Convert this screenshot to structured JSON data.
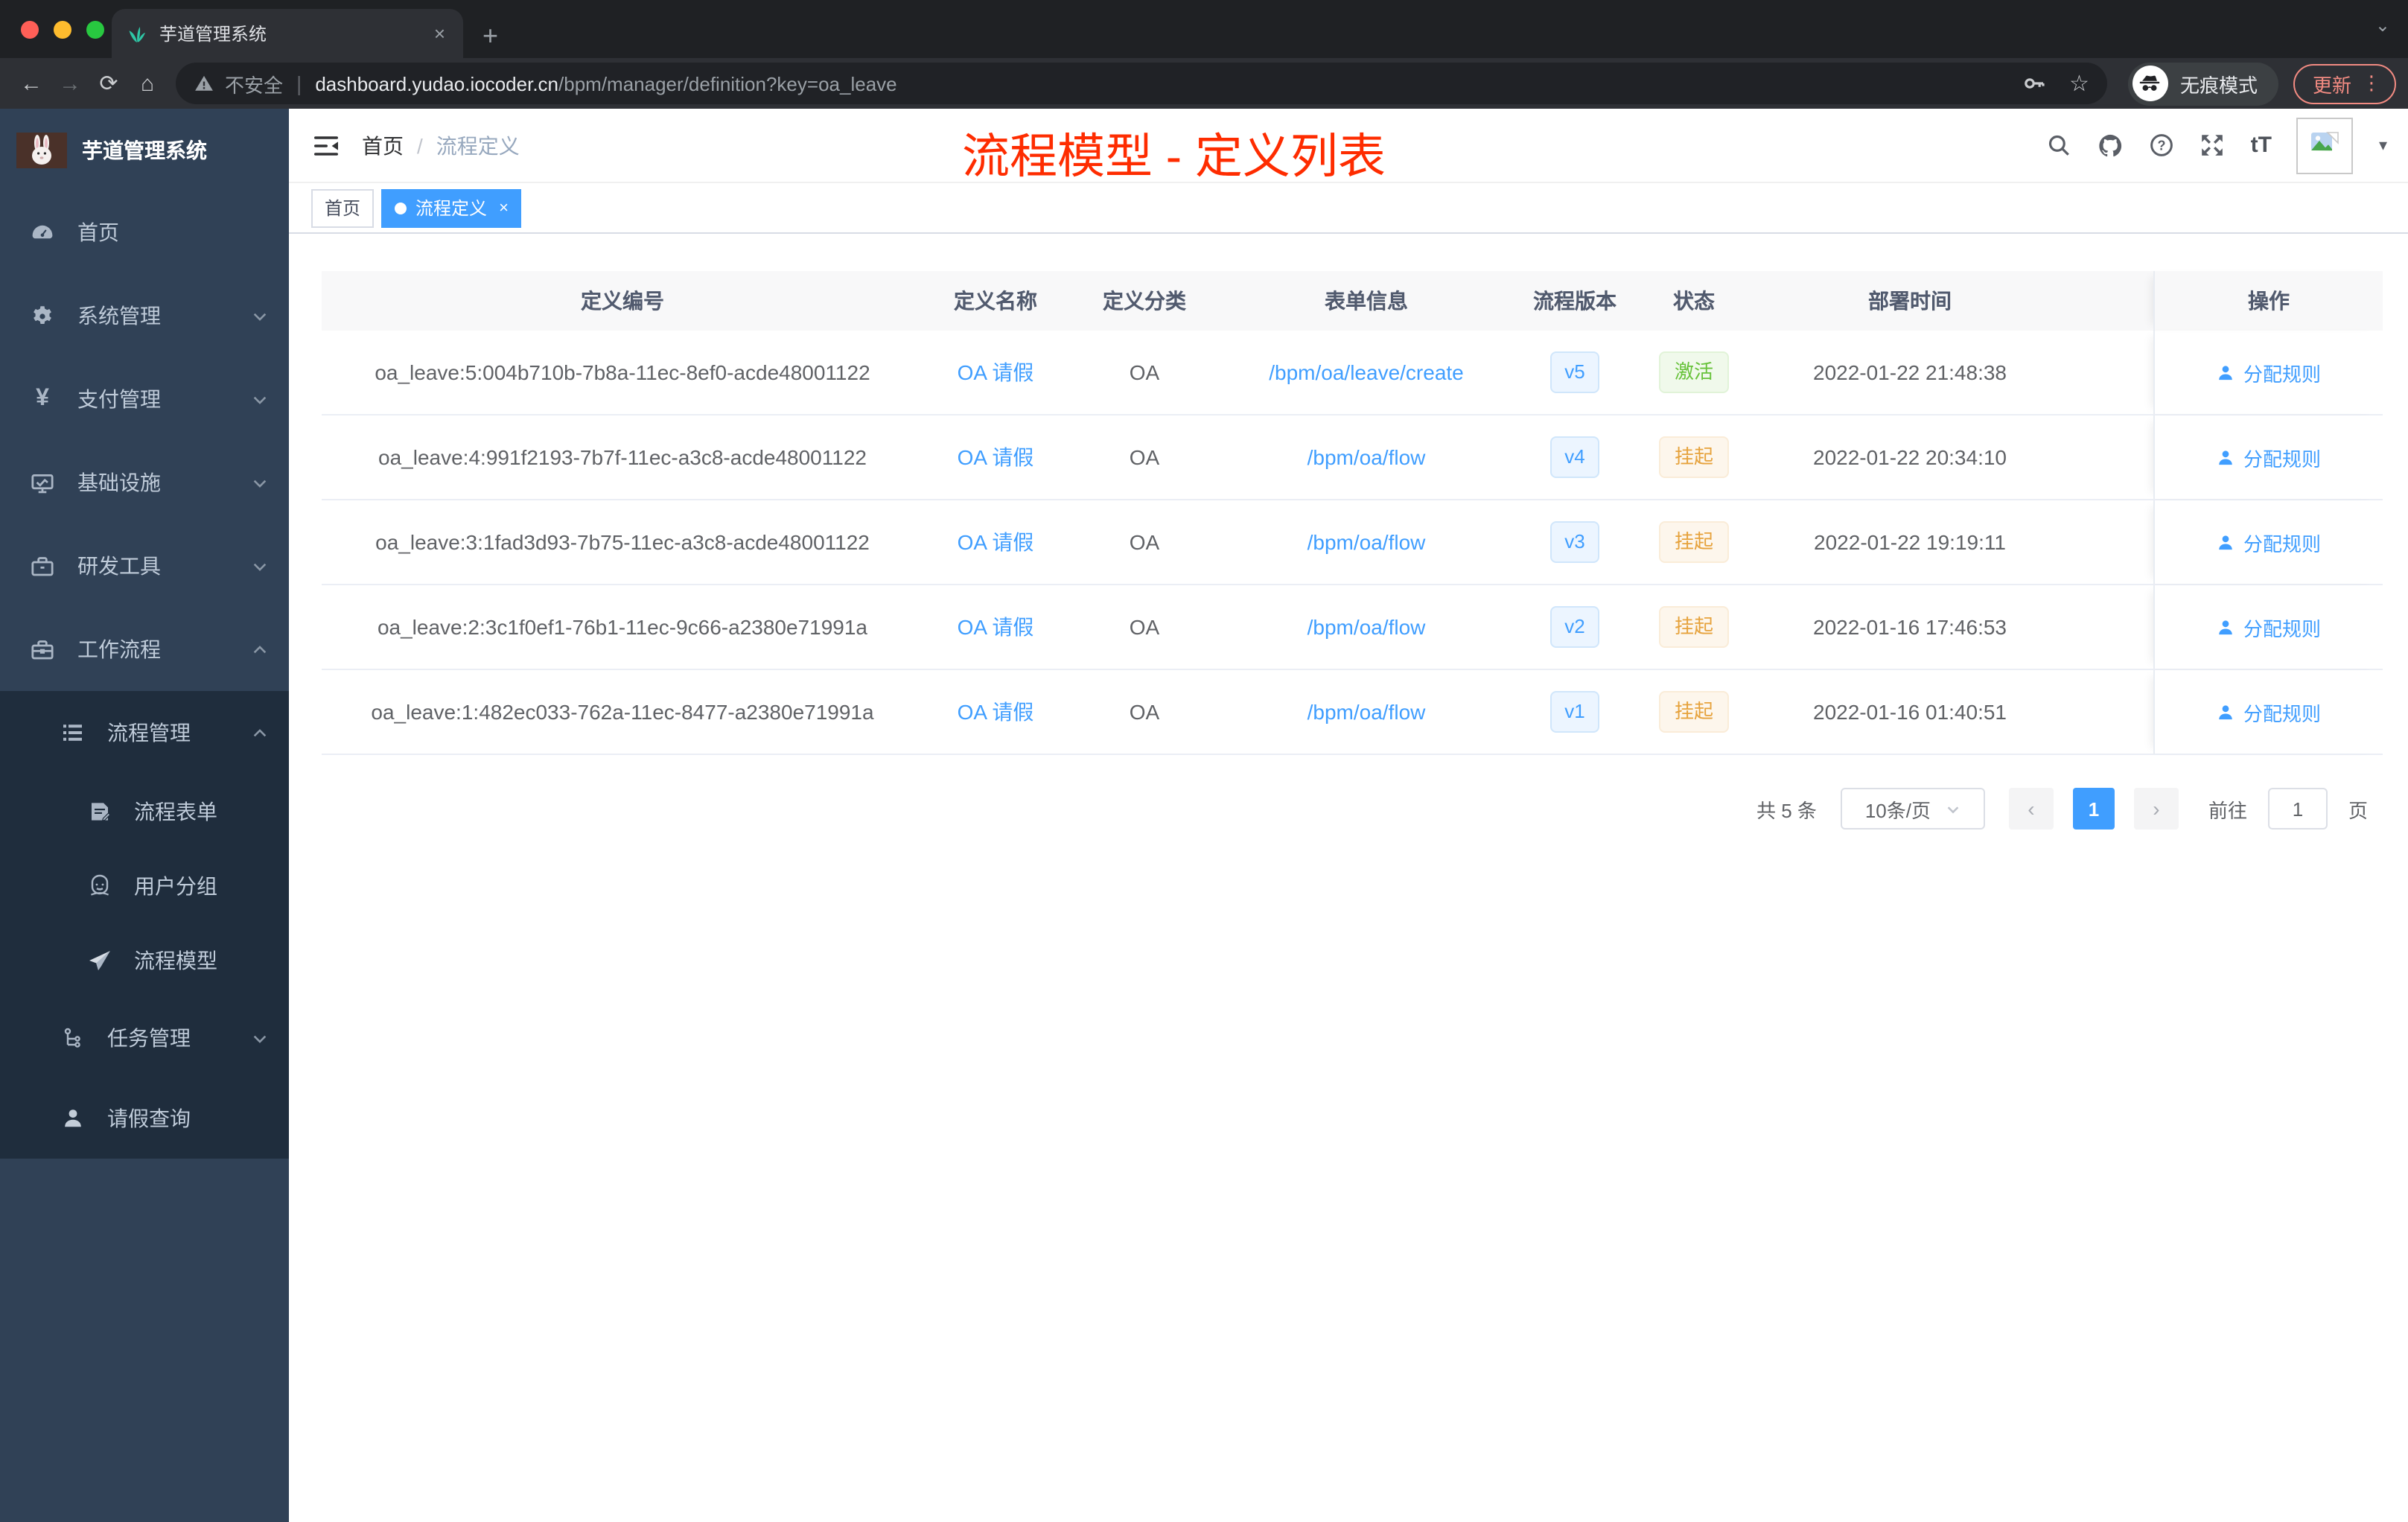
{
  "browser": {
    "tab_title": "芋道管理系统",
    "security_label": "不安全",
    "url_domain": "dashboard.yudao.iocoder.cn",
    "url_path": "/bpm/manager/definition?key=oa_leave",
    "incognito_label": "无痕模式",
    "update_label": "更新",
    "glyphs": {
      "close": "×",
      "new_tab": "+",
      "tab_search": "⌄",
      "back": "←",
      "forward": "→",
      "reload": "⟳",
      "home": "⌂",
      "star": "☆",
      "menu_dots": "⋮"
    }
  },
  "sidebar": {
    "app_title": "芋道管理系统",
    "items": [
      {
        "label": "首页"
      },
      {
        "label": "系统管理"
      },
      {
        "label": "支付管理"
      },
      {
        "label": "基础设施"
      },
      {
        "label": "研发工具"
      },
      {
        "label": "工作流程"
      }
    ],
    "sub": {
      "manage": "流程管理",
      "form": "流程表单",
      "group": "用户分组",
      "model": "流程模型",
      "task": "任务管理",
      "leave": "请假查询"
    }
  },
  "header": {
    "breadcrumb_home": "首页",
    "breadcrumb_sep": "/",
    "breadcrumb_current": "流程定义",
    "font_icon": "tT",
    "caret": "▾",
    "annotation": "流程模型 - 定义列表"
  },
  "tags": {
    "home": "首页",
    "active": "流程定义",
    "close": "×"
  },
  "table": {
    "columns": [
      "定义编号",
      "定义名称",
      "定义分类",
      "表单信息",
      "流程版本",
      "状态",
      "部署时间",
      "操作"
    ],
    "rows": [
      {
        "id": "oa_leave:5:004b710b-7b8a-11ec-8ef0-acde48001122",
        "name": "OA 请假",
        "category": "OA",
        "form": "/bpm/oa/leave/create",
        "version": "v5",
        "status": "激活",
        "deployed": "2022-01-22 21:48:38",
        "action": "分配规则"
      },
      {
        "id": "oa_leave:4:991f2193-7b7f-11ec-a3c8-acde48001122",
        "name": "OA 请假",
        "category": "OA",
        "form": "/bpm/oa/flow",
        "version": "v4",
        "status": "挂起",
        "deployed": "2022-01-22 20:34:10",
        "action": "分配规则"
      },
      {
        "id": "oa_leave:3:1fad3d93-7b75-11ec-a3c8-acde48001122",
        "name": "OA 请假",
        "category": "OA",
        "form": "/bpm/oa/flow",
        "version": "v3",
        "status": "挂起",
        "deployed": "2022-01-22 19:19:11",
        "action": "分配规则"
      },
      {
        "id": "oa_leave:2:3c1f0ef1-76b1-11ec-9c66-a2380e71991a",
        "name": "OA 请假",
        "category": "OA",
        "form": "/bpm/oa/flow",
        "version": "v2",
        "status": "挂起",
        "deployed": "2022-01-16 17:46:53",
        "action": "分配规则"
      },
      {
        "id": "oa_leave:1:482ec033-762a-11ec-8477-a2380e71991a",
        "name": "OA 请假",
        "category": "OA",
        "form": "/bpm/oa/flow",
        "version": "v1",
        "status": "挂起",
        "deployed": "2022-01-16 01:40:51",
        "action": "分配规则"
      }
    ]
  },
  "pagination": {
    "total": "共 5 条",
    "page_size": "10条/页",
    "prev": "‹",
    "page": "1",
    "next": "›",
    "goto_label": "前往",
    "goto_value": "1",
    "unit": "页"
  },
  "colors": {
    "accent": "#409eff",
    "active_green": "#67c23a",
    "suspend_orange": "#e6a23c",
    "annotation_red": "#fe2c00",
    "sidebar_bg": "#304156",
    "submenu_bg": "#1f2d3d"
  }
}
